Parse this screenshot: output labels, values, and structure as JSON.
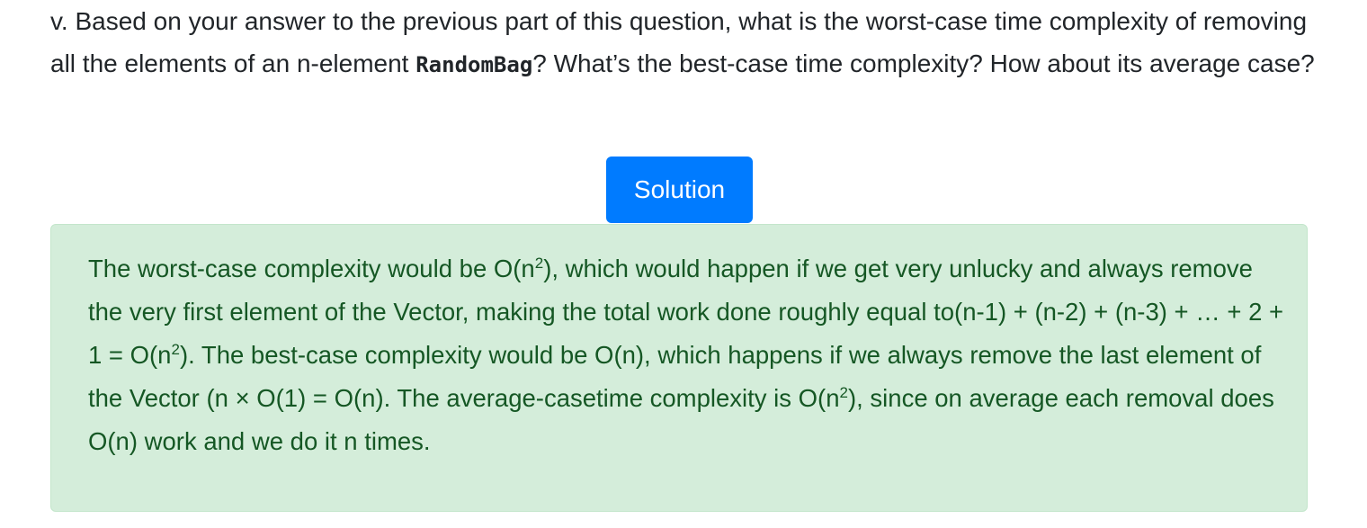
{
  "question": {
    "prefix": "v. Based on your answer to the previous part of this question, what is the worst-case time complexity of removing all the elements of an n-element ",
    "code": "RandomBag",
    "suffix": "? What’s the best-case time complexity? How about its average case?"
  },
  "solution_button": {
    "label": "Solution"
  },
  "solution": {
    "p1": "The worst-case complexity would be O(n",
    "sup1": "2",
    "p2": "), which would happen if we get very unlucky and always remove the very first element of the Vector, making the total work done roughly equal to(n-1) + (n-2) + (n-3) + … + 2 + 1 = O(n",
    "sup2": "2",
    "p3": "). The best-case complexity would be O(n), which happens if we always remove the last element of the Vector (n × O(1) = O(n). The average-casetime complexity is O(n",
    "sup3": "2",
    "p4": "), since on average each removal does O(n) work and we do it n times."
  }
}
